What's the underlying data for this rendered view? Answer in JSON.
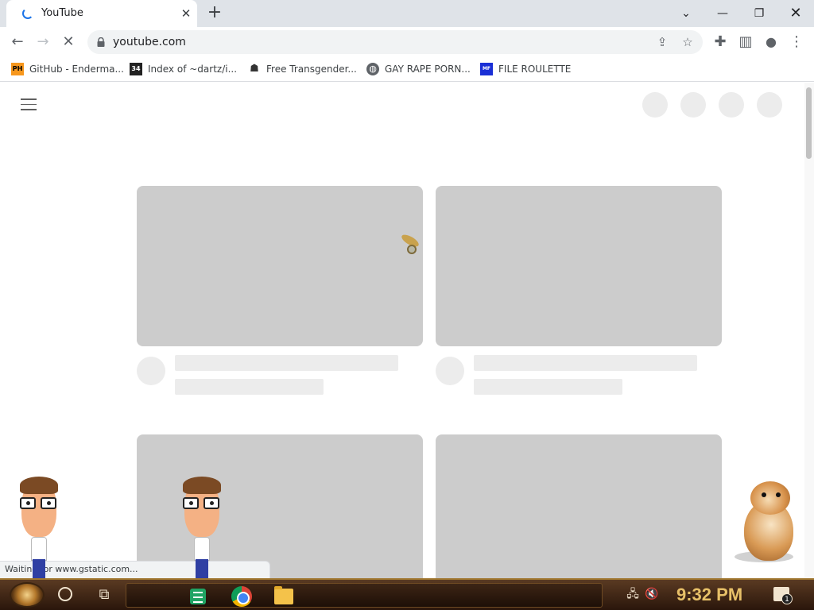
{
  "browser": {
    "tab": {
      "title": "YouTube",
      "close_icon": "close-icon",
      "loading": true
    },
    "new_tab_icon": "plus-icon",
    "window_controls": [
      "chevron-down-icon",
      "minimize-icon",
      "restore-icon",
      "close-icon"
    ],
    "toolbar": {
      "back_icon": "arrow-left-icon",
      "forward_icon": "arrow-right-icon",
      "stop_icon": "stop-loading-icon",
      "url": "youtube.com",
      "omnibox_icons": [
        "share-icon",
        "star-icon"
      ],
      "extensions_icon": "puzzle-icon",
      "sidepanel_icon": "side-panel-icon",
      "profile_icon": "profile-icon",
      "menu_icon": "kebab-menu-icon"
    },
    "bookmarks": [
      {
        "label": "GitHub - Enderma...",
        "icon": "ph-icon"
      },
      {
        "label": "Index of ~dartz/i...",
        "icon": "directory-icon"
      },
      {
        "label": "Free Transgender...",
        "icon": "site-icon"
      },
      {
        "label": "GAY RAPE PORN...",
        "icon": "globe-icon"
      },
      {
        "label": "FILE ROULETTE",
        "icon": "file-roulette-icon"
      }
    ],
    "status_bubble": "Waiting for www.gstatic.com..."
  },
  "page": {
    "menu_icon": "hamburger-icon",
    "state": "loading-skeleton"
  },
  "taskbar": {
    "start_icon": "start-orb-icon",
    "search_icon": "cortana-circle-icon",
    "task_view_icon": "task-view-icon",
    "pinned_apps": [
      "sheets-icon",
      "chrome-icon",
      "file-explorer-icon"
    ],
    "tray_icons": [
      "network-icon",
      "volume-muted-icon"
    ],
    "clock": "9:32 PM",
    "notification_count": "1"
  },
  "colors": {
    "tabstrip": "#dfe3e8",
    "skeleton_thumb": "#cccccc",
    "skeleton_line": "#ececec",
    "taskbar": "#3a2312",
    "clock": "#e7c068"
  }
}
